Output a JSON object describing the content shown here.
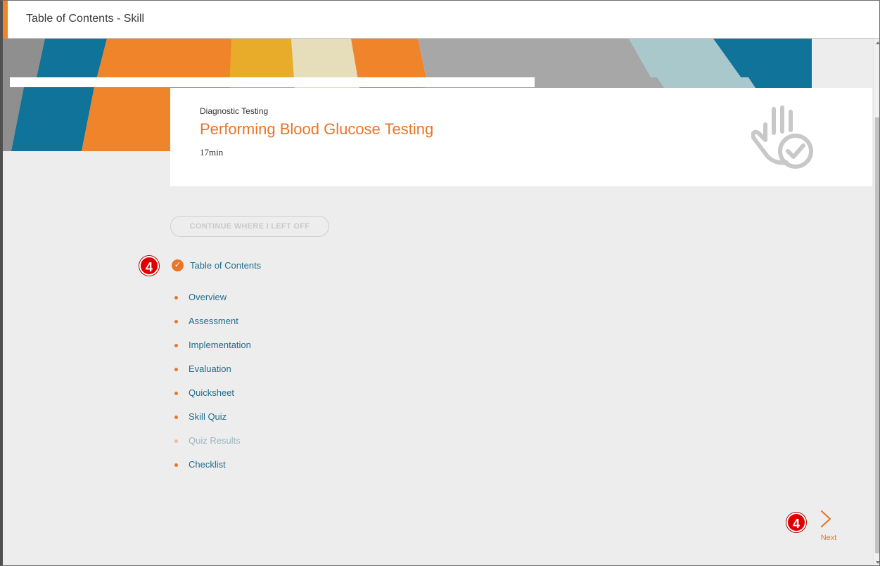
{
  "window": {
    "title": "Table of Contents - Skill"
  },
  "skill": {
    "category": "Diagnostic Testing",
    "title": "Performing Blood Glucose Testing",
    "duration": "17min",
    "icon": "hand-check-icon"
  },
  "continue_button": {
    "label": "CONTINUE WHERE I LEFT OFF"
  },
  "toc": {
    "heading": "Table of Contents",
    "items": [
      {
        "label": "Overview",
        "enabled": true
      },
      {
        "label": "Assessment",
        "enabled": true
      },
      {
        "label": "Implementation",
        "enabled": true
      },
      {
        "label": "Evaluation",
        "enabled": true
      },
      {
        "label": "Quicksheet",
        "enabled": true
      },
      {
        "label": "Skill Quiz",
        "enabled": true
      },
      {
        "label": "Quiz Results",
        "enabled": false
      },
      {
        "label": "Checklist",
        "enabled": true
      }
    ]
  },
  "annotations": {
    "step_badge": "4"
  },
  "navigation": {
    "next_label": "Next"
  },
  "colors": {
    "accent": "#e8752a",
    "link": "#1f6e8c",
    "badge": "#e00000"
  }
}
